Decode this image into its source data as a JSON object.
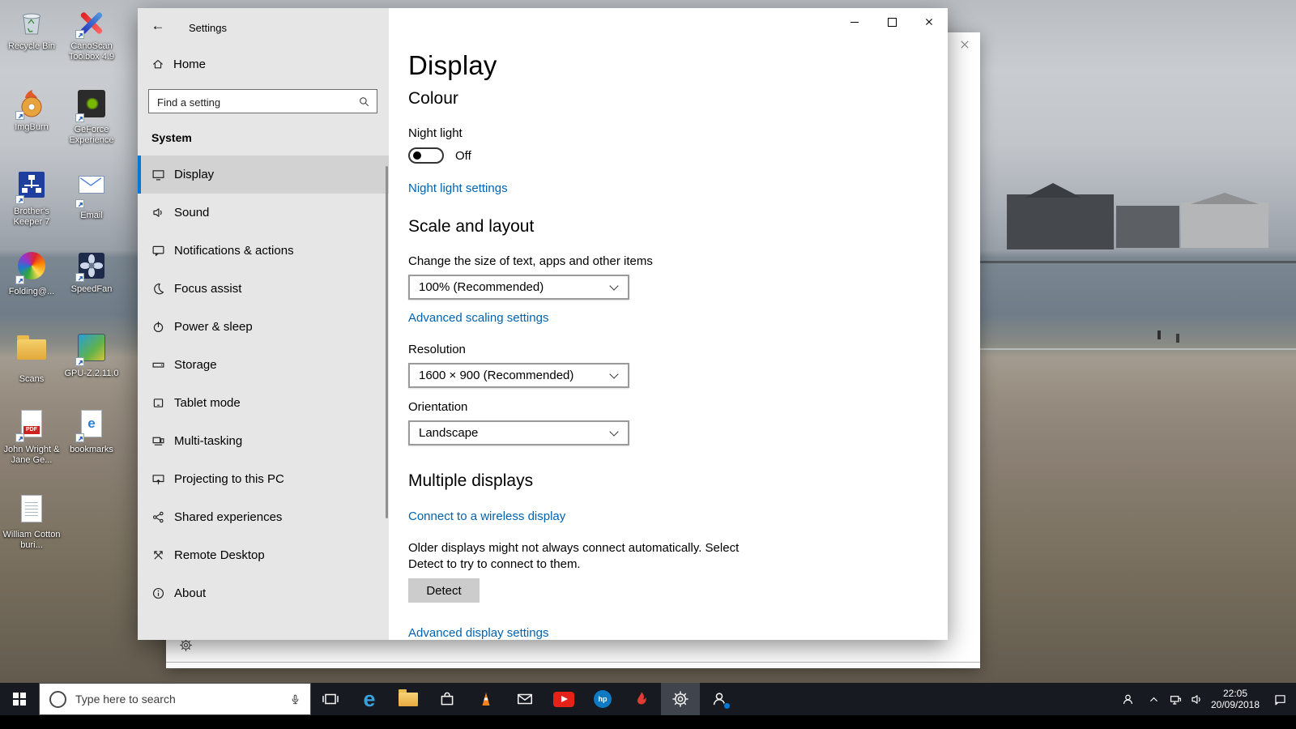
{
  "colors": {
    "accent": "#0078d7",
    "link": "#0063b1"
  },
  "desktop": {
    "icons": [
      {
        "label": "Recycle Bin",
        "icon": "recycle-bin"
      },
      {
        "label": "ImgBurn",
        "icon": "imgburn-disc"
      },
      {
        "label": "Brother's Keeper 7",
        "icon": "brothers-keeper"
      },
      {
        "label": "Folding@...",
        "icon": "folding-sphere"
      },
      {
        "label": "Scans",
        "icon": "folder"
      },
      {
        "label": "John Wright & Jane Ge...",
        "icon": "pdf-file"
      },
      {
        "label": "William Cotton buri...",
        "icon": "text-document"
      },
      {
        "label": "CanoScan Toolbox 4.9",
        "icon": "canoscan"
      },
      {
        "label": "GeForce Experience",
        "icon": "geforce"
      },
      {
        "label": "Email",
        "icon": "email-shortcut"
      },
      {
        "label": "SpeedFan",
        "icon": "speedfan"
      },
      {
        "label": "GPU-Z.2.11.0",
        "icon": "gpu-z"
      },
      {
        "label": "bookmarks",
        "icon": "edge-html-file"
      }
    ],
    "glyphs": {
      "pdf": "PDF",
      "bookmarks_e": "e"
    }
  },
  "settings_window": {
    "titlebar": {
      "title": "Settings"
    },
    "sidebar": {
      "home_label": "Home",
      "search_placeholder": "Find a setting",
      "section_label": "System",
      "items": [
        {
          "label": "Display",
          "icon": "display-icon",
          "selected": true
        },
        {
          "label": "Sound",
          "icon": "speaker-icon"
        },
        {
          "label": "Notifications & actions",
          "icon": "notifications-icon"
        },
        {
          "label": "Focus assist",
          "icon": "moon-icon"
        },
        {
          "label": "Power & sleep",
          "icon": "power-icon"
        },
        {
          "label": "Storage",
          "icon": "drive-icon"
        },
        {
          "label": "Tablet mode",
          "icon": "tablet-icon"
        },
        {
          "label": "Multi-tasking",
          "icon": "multitask-icon"
        },
        {
          "label": "Projecting to this PC",
          "icon": "project-icon"
        },
        {
          "label": "Shared experiences",
          "icon": "share-icon"
        },
        {
          "label": "Remote Desktop",
          "icon": "remote-icon"
        },
        {
          "label": "About",
          "icon": "info-icon"
        }
      ]
    },
    "content": {
      "page_title": "Display",
      "colour": {
        "heading": "Colour",
        "night_light_label": "Night light",
        "night_light_state": "Off",
        "night_light_link": "Night light settings"
      },
      "scale": {
        "heading": "Scale and layout",
        "size_label": "Change the size of text, apps and other items",
        "size_value": "100% (Recommended)",
        "advanced_scaling_link": "Advanced scaling settings",
        "resolution_label": "Resolution",
        "resolution_value": "1600 × 900 (Recommended)",
        "orientation_label": "Orientation",
        "orientation_value": "Landscape"
      },
      "multiple_displays": {
        "heading": "Multiple displays",
        "wireless_link": "Connect to a wireless display",
        "detect_text": "Older displays might not always connect automatically. Select Detect to try to connect to them.",
        "detect_button": "Detect",
        "advanced_display_link": "Advanced display settings"
      }
    }
  },
  "taskbar": {
    "search_placeholder": "Type here to search",
    "glyphs": {
      "edge": "e",
      "hp": "hp"
    },
    "pinned": [
      "start",
      "search",
      "task-view",
      "edge",
      "file-explorer",
      "store",
      "media-app",
      "mail",
      "youtube",
      "hp",
      "music-app",
      "settings",
      "people"
    ],
    "tray": [
      "contact",
      "hidden-icons-chevron",
      "network",
      "volume",
      "clock",
      "action-center"
    ],
    "clock": {
      "time": "22:05",
      "date": "20/09/2018"
    }
  }
}
